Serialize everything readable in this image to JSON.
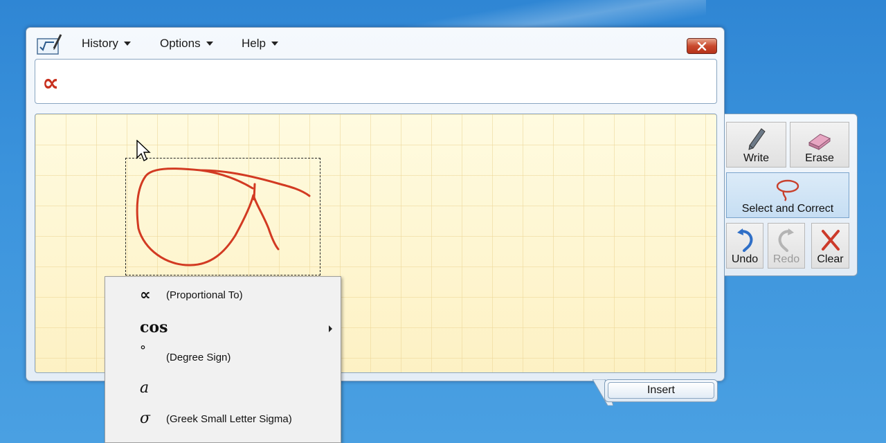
{
  "menubar": {
    "history_label": "History",
    "options_label": "Options",
    "help_label": "Help"
  },
  "preview": {
    "recognized_text": "∝"
  },
  "tools": {
    "write_label": "Write",
    "erase_label": "Erase",
    "select_label": "Select and Correct",
    "undo_label": "Undo",
    "redo_label": "Redo",
    "clear_label": "Clear"
  },
  "insert_label": "Insert",
  "context_menu": {
    "items": [
      {
        "glyph": "∝",
        "description": "(Proportional To)"
      },
      {
        "glyph": "cos",
        "description": ""
      },
      {
        "glyph": "°",
        "description": "(Degree Sign)"
      },
      {
        "glyph": "a",
        "description": ""
      },
      {
        "glyph": "σ",
        "description": "(Greek Small Letter Sigma)"
      }
    ]
  },
  "colors": {
    "ink": "#d23a22",
    "pad_background": "#fff9d6",
    "close_button": "#c9492d"
  }
}
